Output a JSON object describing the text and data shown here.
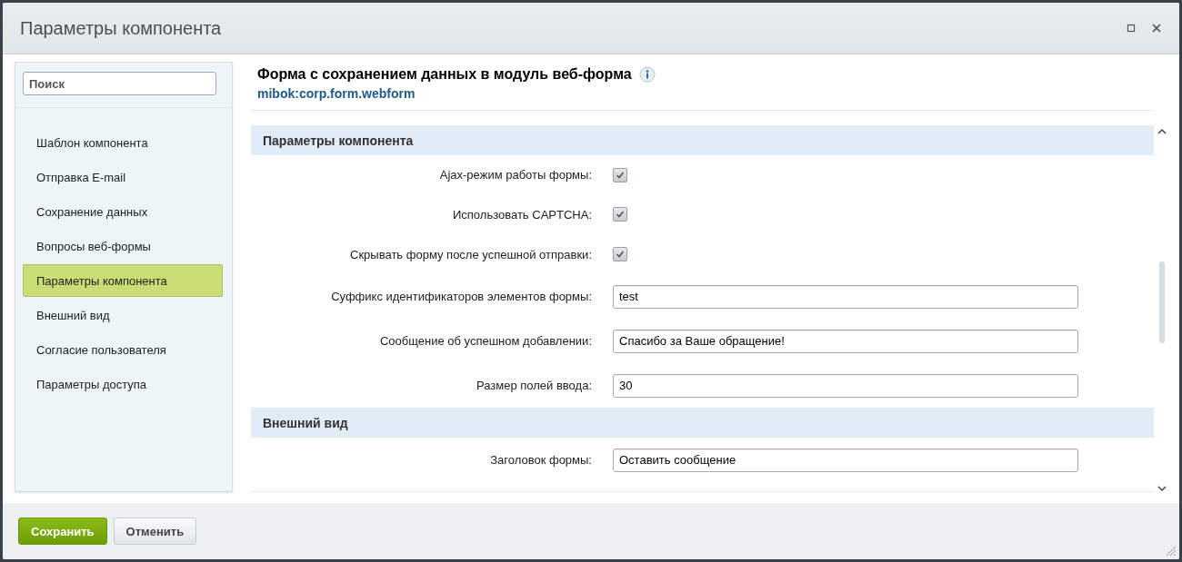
{
  "window": {
    "title": "Параметры компонента"
  },
  "sidebar": {
    "search": {
      "placeholder": "Поиск"
    },
    "items": [
      {
        "label": "Шаблон компонента",
        "selected": false
      },
      {
        "label": "Отправка E-mail",
        "selected": false
      },
      {
        "label": "Сохранение данных",
        "selected": false
      },
      {
        "label": "Вопросы веб-формы",
        "selected": false
      },
      {
        "label": "Параметры компонента",
        "selected": true
      },
      {
        "label": "Внешний вид",
        "selected": false
      },
      {
        "label": "Согласие пользователя",
        "selected": false
      },
      {
        "label": "Параметры доступа",
        "selected": false
      }
    ]
  },
  "header": {
    "title": "Форма с сохранением данных в модуль веб-форма",
    "code": "mibok:corp.form.webform"
  },
  "sections": [
    {
      "title": "Параметры компонента",
      "rows": [
        {
          "kind": "checkbox",
          "label": "Ajax-режим работы формы:",
          "checked": true
        },
        {
          "kind": "checkbox",
          "label": "Использовать CAPTCHA:",
          "checked": true
        },
        {
          "kind": "checkbox",
          "label": "Скрывать форму после успешной отправки:",
          "checked": true
        },
        {
          "kind": "text",
          "label": "Суффикс идентификаторов элементов формы:",
          "value": "test"
        },
        {
          "kind": "text",
          "label": "Сообщение об успешном добавлении:",
          "value": "Спасибо за Ваше обращение!"
        },
        {
          "kind": "text",
          "label": "Размер полей ввода:",
          "value": "30"
        }
      ]
    },
    {
      "title": "Внешний вид",
      "rows": [
        {
          "kind": "text",
          "label": "Заголовок формы:",
          "value": "Оставить сообщение"
        }
      ]
    }
  ],
  "buttons": [
    {
      "label": "Сохранить",
      "kind": "primary"
    },
    {
      "label": "Отменить",
      "kind": "secondary"
    }
  ]
}
